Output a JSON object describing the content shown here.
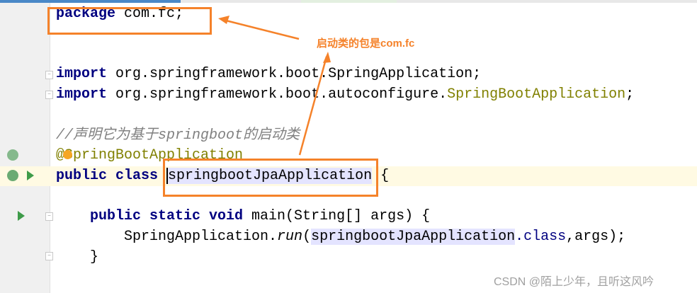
{
  "editor": {
    "lines": {
      "package_kw": "package",
      "package_name": " com.fc;",
      "import_kw": "import",
      "import1": " org.springframework.boot.SpringApplication;",
      "import2_pre": " org.springframework.boot.autoconfigure.",
      "import2_cls": "SpringBootApplication",
      ";": ";",
      "comment": "//声明它为基于springboot的启动类",
      "annotation": "@SpringBootApplication",
      "public_class": "public class ",
      "class_name": "springbootJpaApplication",
      " brace": " {",
      "main_kw": "public static void",
      " main_sig": " main(String[] args) {",
      "run_pre": "SpringApplication.",
      "run": "run",
      "paren": "(",
      "class_ref": "springbootJpaApplication",
      "dot_class": ".class",
      ",args": ",args);",
      "close": "}"
    }
  },
  "annotation_note": "启动类的包是com.fc",
  "watermark": "CSDN @陌上少年，且听这风吟",
  "colors": {
    "highlight": "#f5822a",
    "keyword": "#000080"
  }
}
